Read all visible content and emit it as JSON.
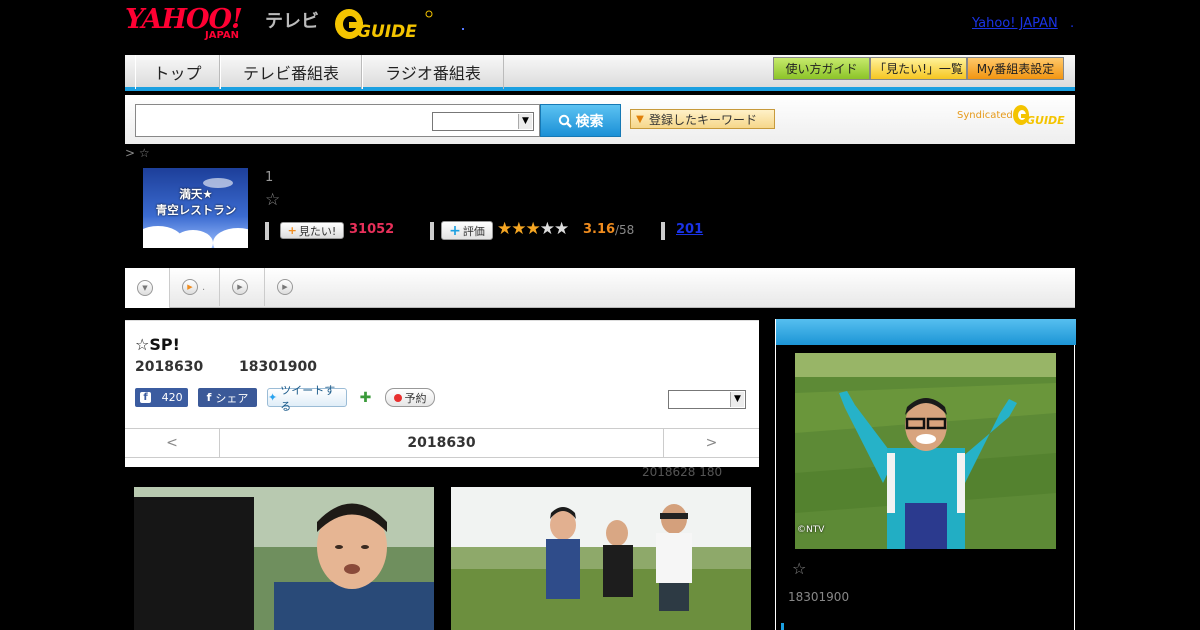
{
  "header": {
    "logo_text": "YAHOO!",
    "logo_sub": "JAPAN",
    "tv_label": "テレビ",
    "gguide_label": "GUIDE",
    "yahoo_japan_link": "Yahoo! JAPAN",
    "link_sep": "."
  },
  "nav": {
    "tabs": [
      {
        "label": "トップ"
      },
      {
        "label": "テレビ番組表"
      },
      {
        "label": "ラジオ番組表"
      }
    ],
    "buttons": [
      {
        "label": "使い方ガイド"
      },
      {
        "label": "「見たい!」一覧"
      },
      {
        "label": "My番組表設定"
      }
    ]
  },
  "search": {
    "input_value": "",
    "select_value": "",
    "search_button": "検索",
    "keyword_button": "登録したキーワード",
    "syndicated": "Syndicated"
  },
  "breadcrumb": "> ☆",
  "program": {
    "thumb_title_line1": "満天★",
    "thumb_title_line2": "青空レストラン",
    "episode_num": "1",
    "star": "☆",
    "mitai_label": "見たい!",
    "mitai_count": "31052",
    "hyoka_label": "評価",
    "stars_on": 3,
    "stars_total": 5,
    "rating": "3.16",
    "rating_count": "/58",
    "review_count": "201"
  },
  "subtabs": [
    {
      "label": ""
    },
    {
      "label": "."
    },
    {
      "label": ""
    },
    {
      "label": ""
    }
  ],
  "main": {
    "title": "☆SP!",
    "date": "2018630",
    "time": "18301900",
    "fb_like_count": "420",
    "fb_share": "シェア",
    "tweet": "ツイートする",
    "reserve": "予約",
    "view_select": "",
    "date_nav_prev": "<",
    "date_nav_date": "2018630",
    "date_nav_next": ">",
    "update_note": "2018628  180"
  },
  "right": {
    "credit": "©NTV",
    "star": "☆",
    "time": "18301900"
  },
  "colors": {
    "accent": "#1ba0e1",
    "yahoo_red": "#ff0033",
    "gguide_yellow": "#f4c400",
    "mitai_pink": "#e8305a",
    "rating_orange": "#f08c1e"
  }
}
